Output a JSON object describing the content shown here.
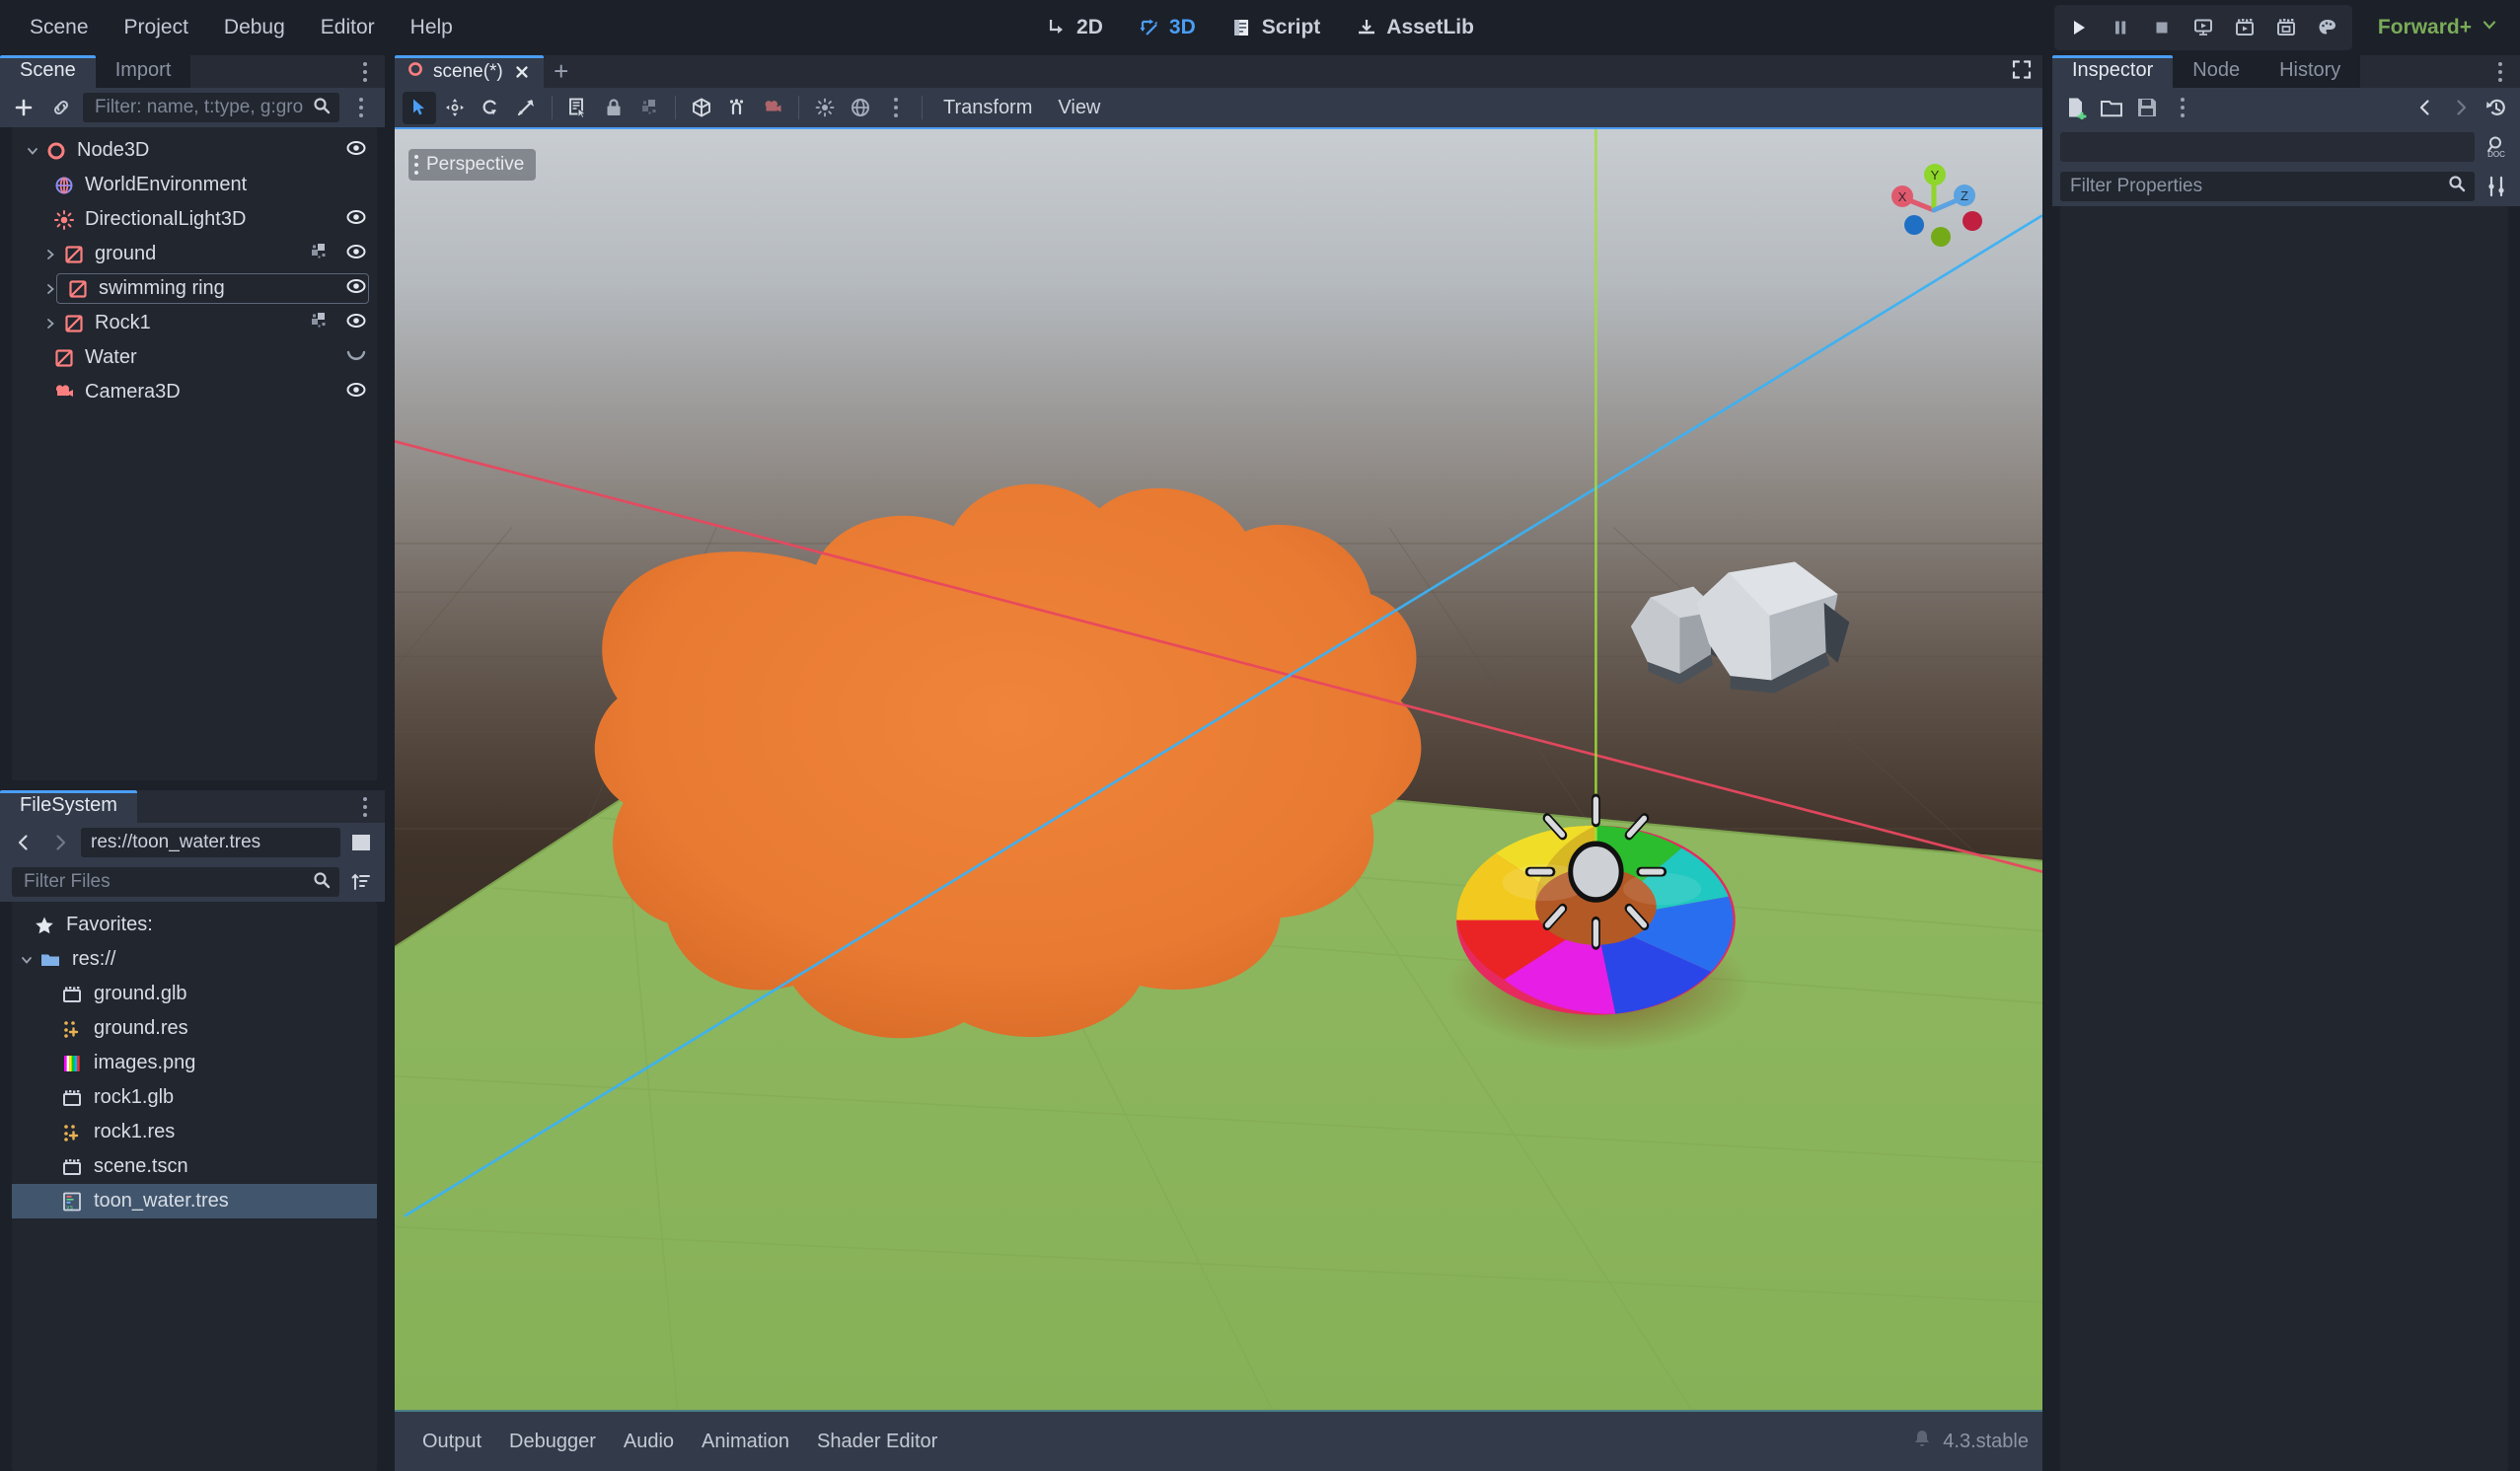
{
  "menubar": {
    "items": [
      {
        "label": "Scene",
        "name": "menu-scene"
      },
      {
        "label": "Project",
        "name": "menu-project"
      },
      {
        "label": "Debug",
        "name": "menu-debug"
      },
      {
        "label": "Editor",
        "name": "menu-editor"
      },
      {
        "label": "Help",
        "name": "menu-help"
      }
    ],
    "mode_tabs": [
      {
        "label": "2D",
        "icon": "2d-icon",
        "active": false
      },
      {
        "label": "3D",
        "icon": "3d-icon",
        "active": true
      },
      {
        "label": "Script",
        "icon": "script-icon",
        "active": false
      },
      {
        "label": "AssetLib",
        "icon": "assetlib-icon",
        "active": false
      }
    ],
    "play_buttons": [
      {
        "name": "run-project-button",
        "icon": "play-icon"
      },
      {
        "name": "pause-scene-button",
        "icon": "pause-icon"
      },
      {
        "name": "stop-scene-button",
        "icon": "stop-icon"
      },
      {
        "name": "run-current-scene-button",
        "icon": "play-scene-icon"
      },
      {
        "name": "run-specific-scene-button",
        "icon": "play-custom-icon"
      },
      {
        "name": "movie-writer-button",
        "icon": "movie-icon"
      },
      {
        "name": "remote-debug-button",
        "icon": "palette-icon"
      }
    ],
    "renderer": {
      "label": "Forward+",
      "color": "#7aab58"
    }
  },
  "left_dock": {
    "tabs": [
      {
        "label": "Scene",
        "active": true
      },
      {
        "label": "Import",
        "active": false
      }
    ],
    "toolbar": {
      "add_node_title": "Add Child Node",
      "instantiate_title": "Instantiate Scene",
      "filter_placeholder": "Filter: name, t:type, g:gro"
    },
    "tree": [
      {
        "label": "Node3D",
        "indent": 0,
        "icon": "node3d-icon",
        "expander": "down",
        "visibility": "eye-icon",
        "script": null,
        "selected": false
      },
      {
        "label": "WorldEnvironment",
        "indent": 1,
        "icon": "worldenvironment-icon",
        "expander": "none",
        "visibility": null,
        "script": null,
        "selected": false
      },
      {
        "label": "DirectionalLight3D",
        "indent": 1,
        "icon": "directionallight3d-icon",
        "expander": "none",
        "visibility": "eye-icon",
        "script": null,
        "selected": false
      },
      {
        "label": "ground",
        "indent": 1,
        "icon": "meshinstance3d-icon",
        "expander": "right",
        "visibility": "eye-icon",
        "script": "mesh-preview-icon",
        "selected": false
      },
      {
        "label": "swimming ring",
        "indent": 1,
        "icon": "meshinstance3d-icon",
        "expander": "right",
        "visibility": "eye-icon",
        "script": null,
        "selected": true
      },
      {
        "label": "Rock1",
        "indent": 1,
        "icon": "meshinstance3d-icon",
        "expander": "right",
        "visibility": "eye-icon",
        "script": "mesh-preview-icon",
        "selected": false
      },
      {
        "label": "Water",
        "indent": 1,
        "icon": "meshinstance3d-icon",
        "expander": "none",
        "visibility": "curve-icon",
        "script": null,
        "selected": false
      },
      {
        "label": "Camera3D",
        "indent": 1,
        "icon": "camera3d-icon",
        "expander": "none",
        "visibility": "eye-icon",
        "script": null,
        "selected": false
      }
    ]
  },
  "filesystem": {
    "tab_label": "FileSystem",
    "path_value": "res://toon_water.tres",
    "filter_placeholder": "Filter Files",
    "entries": [
      {
        "label": "Favorites:",
        "icon": "star-icon",
        "indent": 0,
        "selected": false,
        "expander": "none"
      },
      {
        "label": "res://",
        "icon": "folder-icon",
        "indent": 0,
        "selected": false,
        "expander": "down"
      },
      {
        "label": "ground.glb",
        "icon": "packedscene-icon",
        "indent": 1,
        "selected": false,
        "expander": "none"
      },
      {
        "label": "ground.res",
        "icon": "resource-icon",
        "indent": 1,
        "selected": false,
        "expander": "none"
      },
      {
        "label": "images.png",
        "icon": "image-icon",
        "indent": 1,
        "selected": false,
        "expander": "none"
      },
      {
        "label": "rock1.glb",
        "icon": "packedscene-icon",
        "indent": 1,
        "selected": false,
        "expander": "none"
      },
      {
        "label": "rock1.res",
        "icon": "resource-icon",
        "indent": 1,
        "selected": false,
        "expander": "none"
      },
      {
        "label": "scene.tscn",
        "icon": "packedscene-icon",
        "indent": 1,
        "selected": false,
        "expander": "none"
      },
      {
        "label": "toon_water.tres",
        "icon": "shadermaterial-icon",
        "indent": 1,
        "selected": true,
        "expander": "none"
      }
    ]
  },
  "center": {
    "scene_tabs": [
      {
        "label": "scene(*)",
        "active": true,
        "icon": "node3d-icon"
      }
    ],
    "new_tab_label": "+",
    "viewport_toolbar": {
      "buttons": [
        {
          "name": "select-mode-button",
          "icon": "cursor-icon",
          "active": true
        },
        {
          "name": "move-mode-button",
          "icon": "move-icon",
          "active": false
        },
        {
          "name": "rotate-mode-button",
          "icon": "rotate-icon",
          "active": false
        },
        {
          "name": "scale-mode-button",
          "icon": "scale-icon",
          "active": false
        },
        {
          "name": "list-select-button",
          "icon": "list-select-icon",
          "active": false
        },
        {
          "name": "lock-button",
          "icon": "lock-icon",
          "active": false
        },
        {
          "name": "group-button",
          "icon": "group-icon",
          "active": false
        },
        {
          "name": "local-space-button",
          "icon": "local-space-icon",
          "active": false
        },
        {
          "name": "snap-button",
          "icon": "snap-icon",
          "active": false
        },
        {
          "name": "camera-preview-button",
          "icon": "camera-icon",
          "active": false
        },
        {
          "name": "sun-preview-button",
          "icon": "sun-icon",
          "active": false
        },
        {
          "name": "environment-preview-button",
          "icon": "globe-icon",
          "active": false
        },
        {
          "name": "viewport-options-button",
          "icon": "kebab-icon",
          "active": false
        }
      ],
      "menus": [
        {
          "label": "Transform",
          "name": "transform-menu"
        },
        {
          "label": "View",
          "name": "view-menu"
        }
      ]
    },
    "viewport": {
      "camera_label": "Perspective",
      "gizmo_axes": [
        {
          "label": "X",
          "color": "#e05a6e"
        },
        {
          "label": "Y",
          "color": "#8ed62b"
        },
        {
          "label": "Z",
          "color": "#5ba2e0"
        }
      ]
    },
    "bottom_tabs": [
      {
        "label": "Output"
      },
      {
        "label": "Debugger"
      },
      {
        "label": "Audio"
      },
      {
        "label": "Animation"
      },
      {
        "label": "Shader Editor"
      }
    ],
    "version": "4.3.stable"
  },
  "right_dock": {
    "tabs": [
      {
        "label": "Inspector",
        "active": true
      },
      {
        "label": "Node",
        "active": false
      },
      {
        "label": "History",
        "active": false
      }
    ],
    "toolbar": [
      {
        "name": "new-resource-button",
        "icon": "new-resource-icon"
      },
      {
        "name": "load-resource-button",
        "icon": "folder-open-icon"
      },
      {
        "name": "save-resource-button",
        "icon": "save-icon"
      },
      {
        "name": "resource-extra-button",
        "icon": "kebab-icon"
      },
      {
        "name": "history-prev-button",
        "icon": "chevron-left-icon"
      },
      {
        "name": "history-next-button",
        "icon": "chevron-right-icon"
      },
      {
        "name": "history-button",
        "icon": "history-icon"
      },
      {
        "name": "open-docs-button",
        "icon": "doc-search-icon"
      },
      {
        "name": "object-tools-button",
        "icon": "tools-icon"
      }
    ],
    "filter_placeholder": "Filter Properties"
  },
  "colors": {
    "accent": "#4a9ef5",
    "panel": "#333b4a",
    "bg": "#1c2029",
    "field": "#21262f",
    "selection": "#41566d",
    "node_red": "#fc7f7f",
    "renderer_green": "#7aab58"
  }
}
